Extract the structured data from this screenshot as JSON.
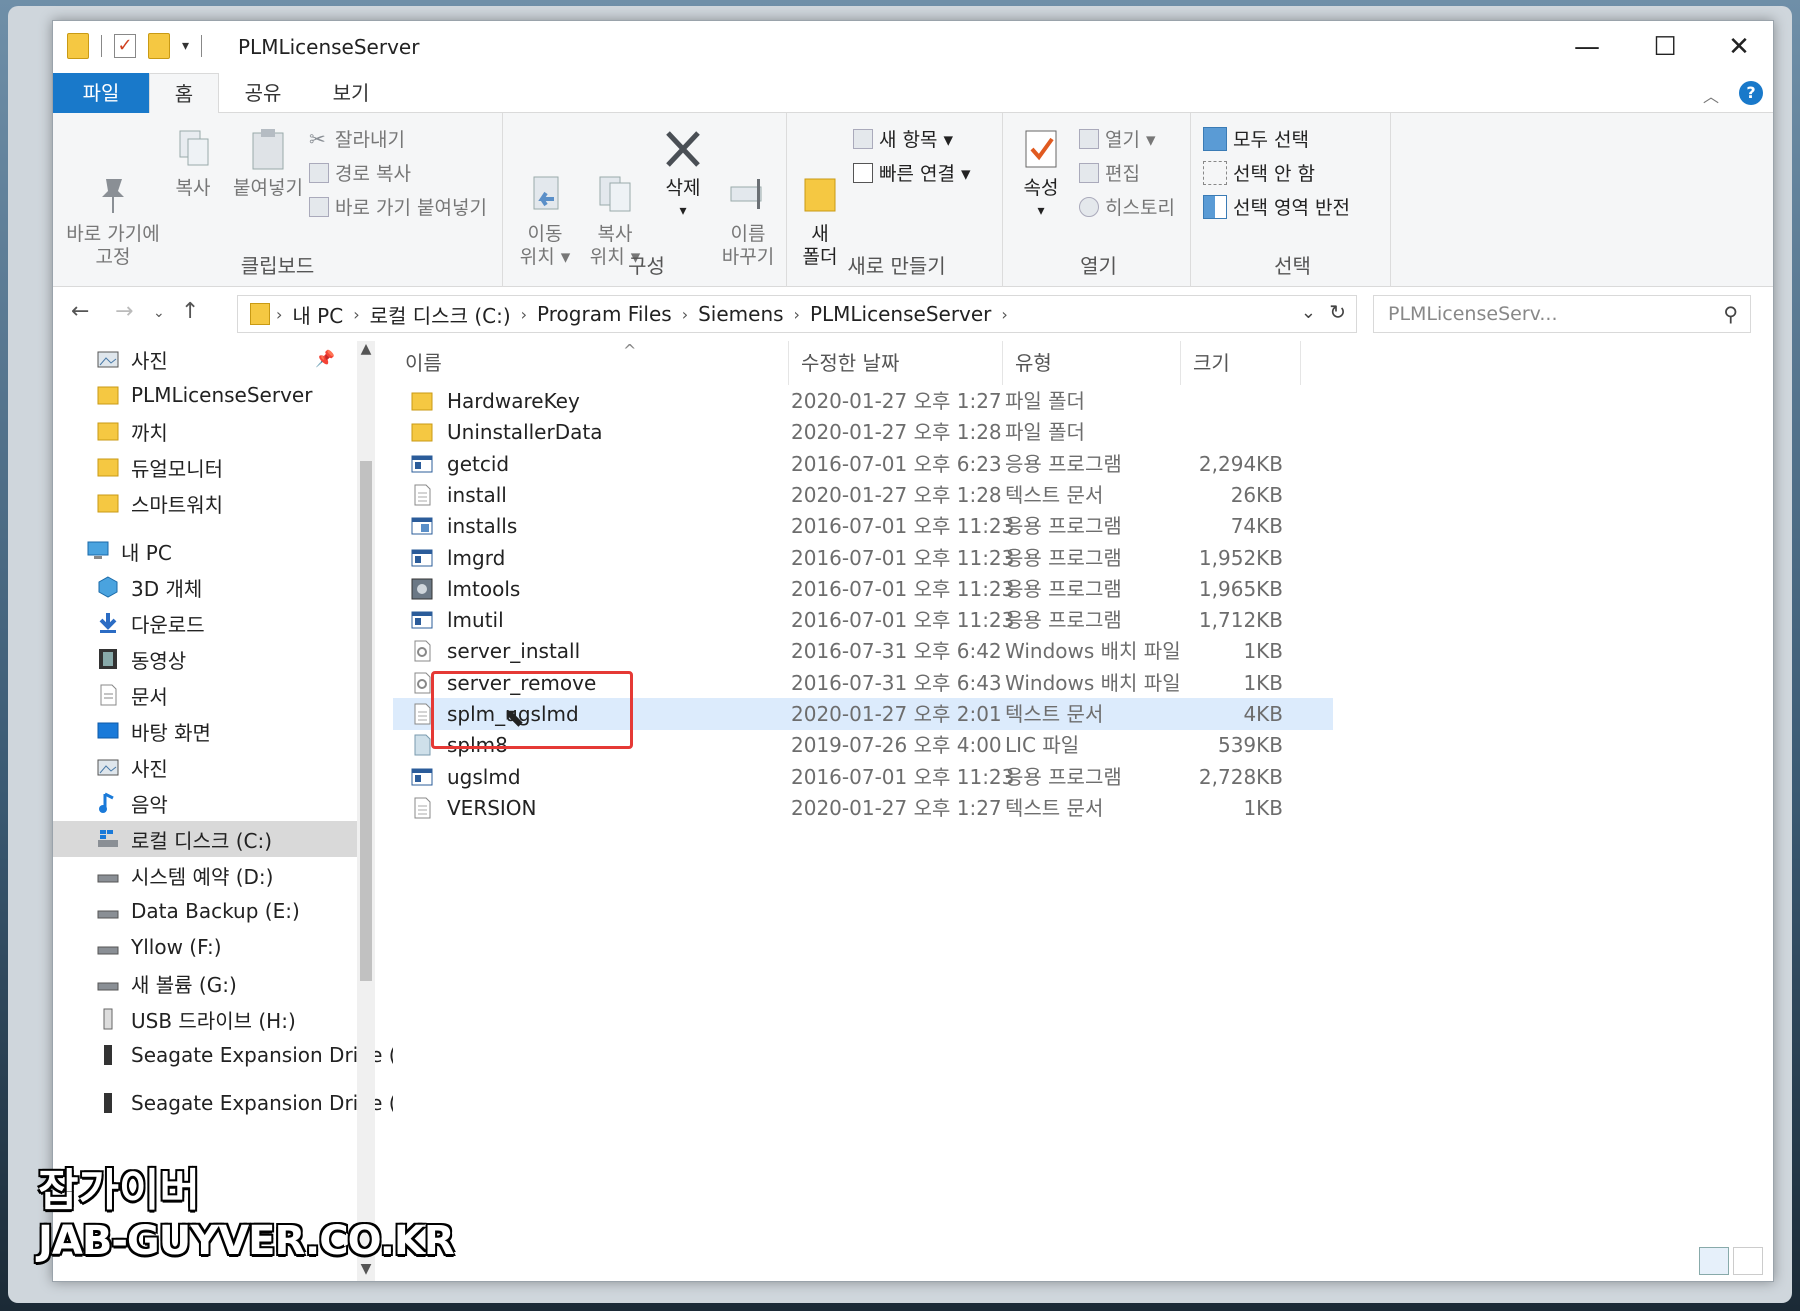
{
  "window": {
    "title": "PLMLicenseServer",
    "controls": {
      "minimize": "—",
      "maximize": "☐",
      "close": "✕"
    }
  },
  "ribbon_tabs": {
    "file": "파일",
    "home": "홈",
    "share": "공유",
    "view": "보기"
  },
  "ribbon": {
    "clipboard": {
      "label": "클립보드",
      "pin": "바로 가기에\n고정",
      "copy": "복사",
      "paste": "붙여넣기",
      "cut": "잘라내기",
      "copy_path": "경로 복사",
      "paste_shortcut": "바로 가기 붙여넣기"
    },
    "organize": {
      "label": "구성",
      "move_to": "이동\n위치 ▾",
      "copy_to": "복사\n위치 ▾",
      "delete": "삭제",
      "rename": "이름\n바꾸기"
    },
    "new": {
      "label": "새로 만들기",
      "new_folder": "새\n폴더",
      "new_item": "새 항목 ▾",
      "easy_access": "빠른 연결 ▾"
    },
    "open": {
      "label": "열기",
      "properties": "속성",
      "open": "열기 ▾",
      "edit": "편집",
      "history": "히스토리"
    },
    "select": {
      "label": "선택",
      "select_all": "모두 선택",
      "select_none": "선택 안 함",
      "invert": "선택 영역 반전"
    }
  },
  "address": {
    "segments": [
      "내 PC",
      "로컬 디스크 (C:)",
      "Program Files",
      "Siemens",
      "PLMLicenseServer"
    ],
    "search_placeholder": "PLMLicenseServ..."
  },
  "nav": [
    {
      "label": "사진",
      "icon": "pictures-icon"
    },
    {
      "label": "PLMLicenseServer",
      "icon": "folder-icon"
    },
    {
      "label": "까치",
      "icon": "folder-icon"
    },
    {
      "label": "듀얼모니터",
      "icon": "folder-icon"
    },
    {
      "label": "스마트워치",
      "icon": "folder-icon"
    },
    {
      "label": "내 PC",
      "icon": "computer-icon"
    },
    {
      "label": "3D 개체",
      "icon": "3d-objects-icon"
    },
    {
      "label": "다운로드",
      "icon": "download-icon"
    },
    {
      "label": "동영상",
      "icon": "video-icon"
    },
    {
      "label": "문서",
      "icon": "document-icon"
    },
    {
      "label": "바탕 화면",
      "icon": "desktop-icon"
    },
    {
      "label": "사진",
      "icon": "pictures-icon"
    },
    {
      "label": "음악",
      "icon": "music-icon"
    },
    {
      "label": "로컬 디스크 (C:)",
      "icon": "local-disk-icon"
    },
    {
      "label": "시스템 예약 (D:)",
      "icon": "drive-icon"
    },
    {
      "label": "Data Backup (E:)",
      "icon": "drive-icon"
    },
    {
      "label": "Yllow (F:)",
      "icon": "drive-icon"
    },
    {
      "label": "새 볼륨 (G:)",
      "icon": "drive-icon"
    },
    {
      "label": "USB 드라이브 (H:)",
      "icon": "usb-drive-icon"
    },
    {
      "label": "Seagate Expansion Drive (J",
      "icon": "external-drive-icon"
    },
    {
      "label": "Seagate Expansion Drive (J:)",
      "icon": "external-drive-icon"
    }
  ],
  "columns": {
    "name": "이름",
    "date": "수정한 날짜",
    "type": "유형",
    "size": "크기"
  },
  "files": [
    {
      "name": "HardwareKey",
      "date": "2020-01-27 오후 1:27",
      "type": "파일 폴더",
      "size": "",
      "icon": "folder-icon"
    },
    {
      "name": "UninstallerData",
      "date": "2020-01-27 오후 1:28",
      "type": "파일 폴더",
      "size": "",
      "icon": "folder-icon"
    },
    {
      "name": "getcid",
      "date": "2016-07-01 오후 6:23",
      "type": "응용 프로그램",
      "size": "2,294KB",
      "icon": "application-icon"
    },
    {
      "name": "install",
      "date": "2020-01-27 오후 1:28",
      "type": "텍스트 문서",
      "size": "26KB",
      "icon": "text-file-icon"
    },
    {
      "name": "installs",
      "date": "2016-07-01 오후 11:23",
      "type": "응용 프로그램",
      "size": "74KB",
      "icon": "installer-icon"
    },
    {
      "name": "lmgrd",
      "date": "2016-07-01 오후 11:23",
      "type": "응용 프로그램",
      "size": "1,952KB",
      "icon": "application-icon"
    },
    {
      "name": "lmtools",
      "date": "2016-07-01 오후 11:23",
      "type": "응용 프로그램",
      "size": "1,965KB",
      "icon": "lmtools-icon"
    },
    {
      "name": "lmutil",
      "date": "2016-07-01 오후 11:23",
      "type": "응용 프로그램",
      "size": "1,712KB",
      "icon": "application-icon"
    },
    {
      "name": "server_install",
      "date": "2016-07-31 오후 6:42",
      "type": "Windows 배치 파일",
      "size": "1KB",
      "icon": "batch-file-icon"
    },
    {
      "name": "server_remove",
      "date": "2016-07-31 오후 6:43",
      "type": "Windows 배치 파일",
      "size": "1KB",
      "icon": "batch-file-icon"
    },
    {
      "name": "splm_ugslmd",
      "date": "2020-01-27 오후 2:01",
      "type": "텍스트 문서",
      "size": "4KB",
      "icon": "text-file-icon"
    },
    {
      "name": "splm8",
      "date": "2019-07-26 오후 4:00",
      "type": "LIC 파일",
      "size": "539KB",
      "icon": "lic-file-icon"
    },
    {
      "name": "ugslmd",
      "date": "2016-07-01 오후 11:23",
      "type": "응용 프로그램",
      "size": "2,728KB",
      "icon": "application-icon"
    },
    {
      "name": "VERSION",
      "date": "2020-01-27 오후 1:27",
      "type": "텍스트 문서",
      "size": "1KB",
      "icon": "text-file-icon"
    }
  ],
  "selected_file": "splm_ugslmd",
  "watermark": {
    "line1": "잡가이버",
    "line2": "JAB-GUYVER.CO.KR"
  },
  "colors": {
    "accent": "#1979ca",
    "folder": "#f5c842",
    "highlight_box": "#e53935",
    "selection": "#dcebfc"
  }
}
